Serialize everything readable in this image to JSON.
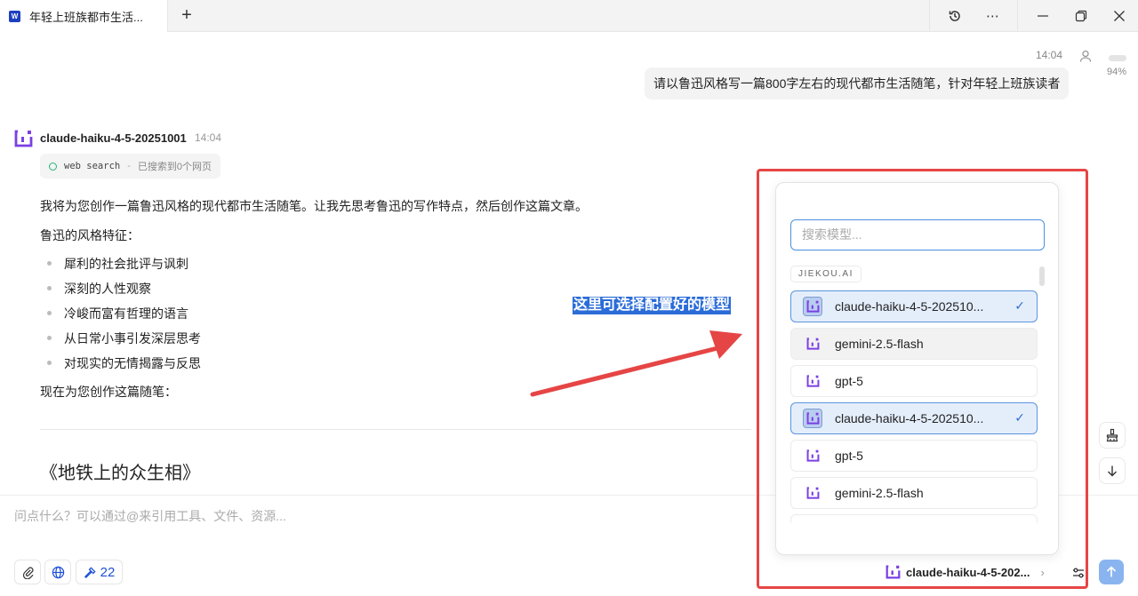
{
  "tab": {
    "title": "年轻上班族都市生活...",
    "new_tab": "+"
  },
  "window": {
    "history": "history-icon",
    "more": "⋯"
  },
  "user_msg": {
    "time": "14:04",
    "zoom": "94%",
    "text": "请以鲁迅风格写一篇800字左右的现代都市生活随笔，针对年轻上班族读者"
  },
  "ai": {
    "name": "claude-haiku-4-5-20251001",
    "time": "14:04",
    "tool": {
      "name": "web search",
      "sep": "-",
      "status": "已搜索到0个网页"
    },
    "intro": "我将为您创作一篇鲁迅风格的现代都市生活随笔。让我先思考鲁迅的写作特点，然后创作这篇文章。",
    "style_heading": "鲁迅的风格特征：",
    "features": [
      "犀利的社会批评与讽刺",
      "深刻的人性观察",
      "冷峻而富有哲理的语言",
      "从日常小事引发深层思考",
      "对现实的无情揭露与反思"
    ],
    "lead": "现在为您创作这篇随笔：",
    "article_title": "《地铁上的众生相》"
  },
  "annotation": "这里可选择配置好的模型",
  "dropdown": {
    "search_placeholder": "搜索模型...",
    "group": "JIEKOU.AI",
    "models": [
      {
        "name": "claude-haiku-4-5-202510...",
        "selected": true
      },
      {
        "name": "gemini-2.5-flash",
        "selected": false
      },
      {
        "name": "gpt-5",
        "selected": false
      },
      {
        "name": "claude-haiku-4-5-202510...",
        "selected": true
      },
      {
        "name": "gpt-5",
        "selected": false
      },
      {
        "name": "gemini-2.5-flash",
        "selected": false
      }
    ],
    "check": "✓"
  },
  "input": {
    "placeholder": "问点什么？可以通过@来引用工具、文件、资源...",
    "tools_count": "22"
  },
  "current_model": "claude-haiku-4-5-202...",
  "colors": {
    "accent": "#2f6fd0",
    "brand": "#7b3fe4",
    "highlight": "#e64545"
  }
}
